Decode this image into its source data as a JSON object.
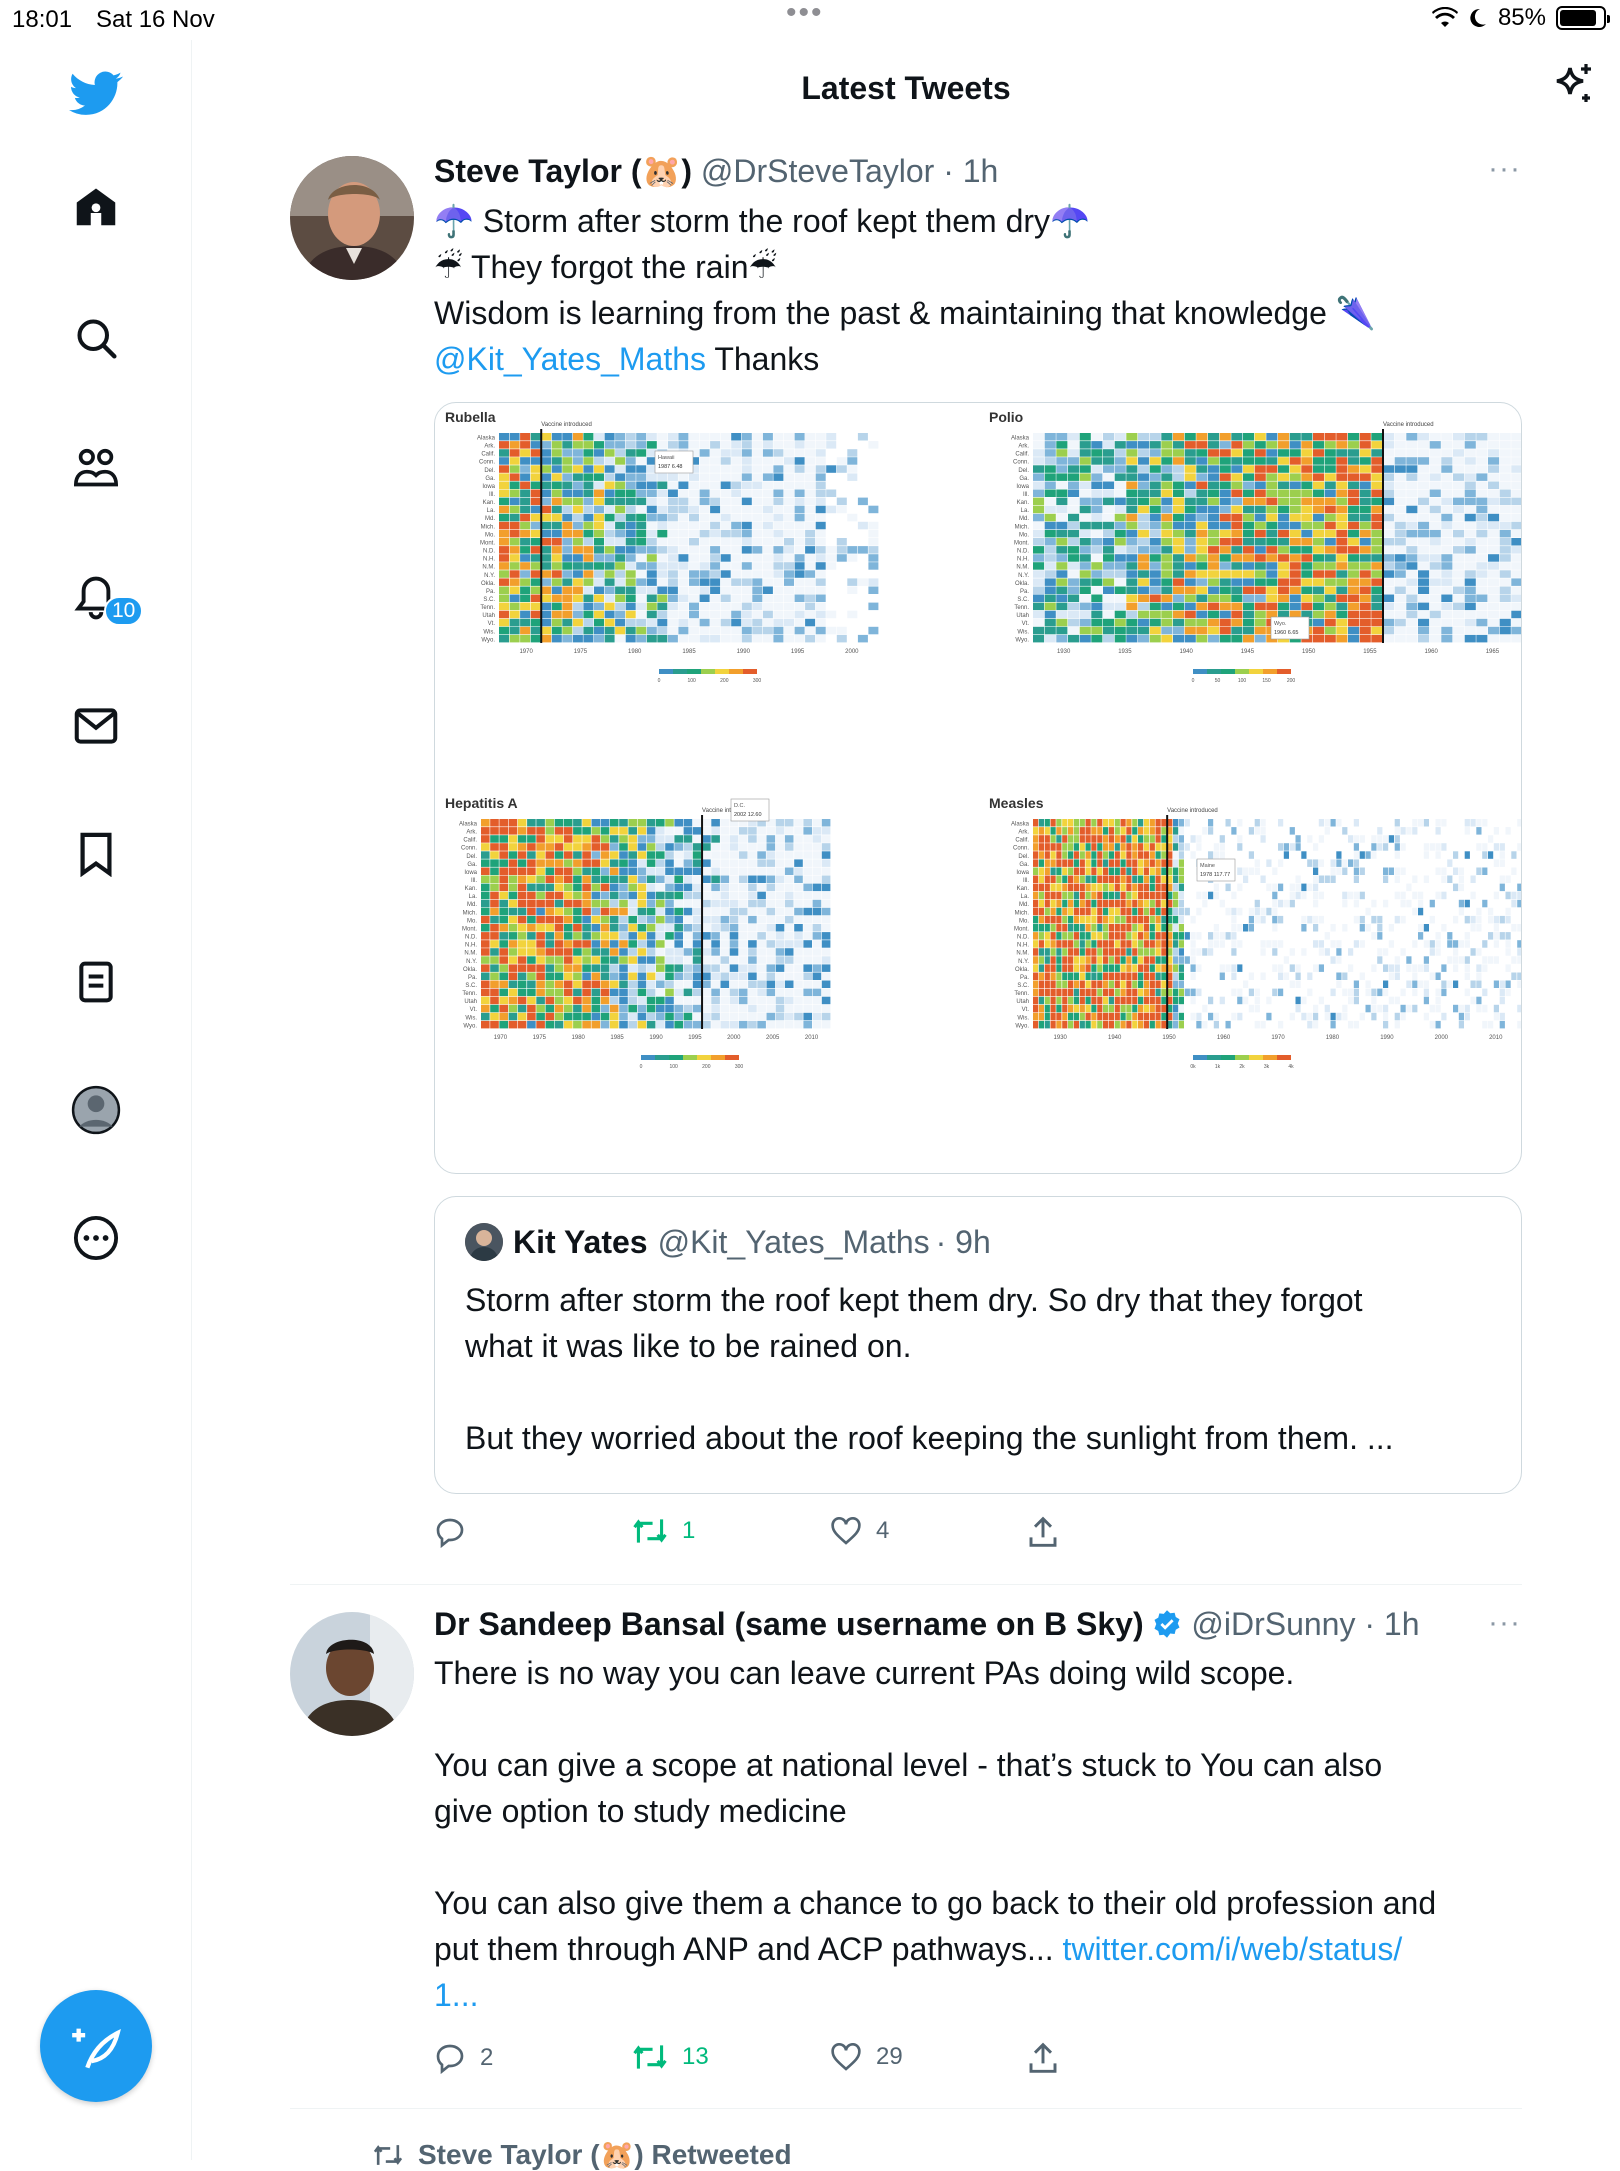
{
  "status_bar": {
    "time": "18:01",
    "date": "Sat 16 Nov",
    "battery": "85%"
  },
  "header": {
    "title": "Latest Tweets"
  },
  "sidebar": {
    "items": [
      {
        "name": "home"
      },
      {
        "name": "explore"
      },
      {
        "name": "communities"
      },
      {
        "name": "notifications",
        "badge": "10"
      },
      {
        "name": "messages"
      },
      {
        "name": "bookmarks"
      },
      {
        "name": "lists"
      },
      {
        "name": "profile"
      },
      {
        "name": "more"
      }
    ]
  },
  "tweets": [
    {
      "name": "Steve Taylor (🐹)",
      "handle": "@DrSteveTaylor",
      "time": "· 1h",
      "text_lines": [
        "☂️ Storm after storm the roof kept them dry☂️",
        "☔ They forgot the rain☔",
        "Wisdom is learning from the past & maintaining that knowledge 🌂"
      ],
      "mention": "@Kit_Yates_Maths",
      "mention_suffix": " Thanks",
      "media": {
        "panels": [
          {
            "title": "Rubella",
            "vaccine_label": "Vaccine introduced",
            "tooltip_state": "Hawaii",
            "tooltip_year": "1987",
            "tooltip_value": "6.48",
            "x_ticks": [
              "1970",
              "1975",
              "1980",
              "1985",
              "1990",
              "1995",
              "2000"
            ],
            "legend_ticks": [
              "0",
              "100",
              "200",
              "300"
            ]
          },
          {
            "title": "Polio",
            "vaccine_label": "Vaccine introduced",
            "tooltip_state": "Wyo.",
            "tooltip_year": "1960",
            "tooltip_value": "6.65",
            "x_ticks": [
              "1930",
              "1935",
              "1940",
              "1945",
              "1950",
              "1955",
              "1960",
              "1965"
            ],
            "legend_ticks": [
              "0",
              "50",
              "100",
              "150",
              "200"
            ]
          },
          {
            "title": "Hepatitis A",
            "vaccine_label": "Vaccine introduced",
            "tooltip_state": "D.C.",
            "tooltip_year": "2002",
            "tooltip_value": "12.60",
            "x_ticks": [
              "1970",
              "1975",
              "1980",
              "1985",
              "1990",
              "1995",
              "2000",
              "2005",
              "2010"
            ],
            "legend_ticks": [
              "0",
              "100",
              "200",
              "300"
            ]
          },
          {
            "title": "Measles",
            "vaccine_label": "Vaccine introduced",
            "tooltip_state": "Maine",
            "tooltip_year": "1978",
            "tooltip_value": "117.77",
            "x_ticks": [
              "1930",
              "1940",
              "1950",
              "1960",
              "1970",
              "1980",
              "1990",
              "2000",
              "2010"
            ],
            "legend_ticks": [
              "0k",
              "1k",
              "2k",
              "3k",
              "4k"
            ]
          }
        ],
        "states": [
          "Alaska",
          "Ark.",
          "Calif.",
          "Conn.",
          "Del.",
          "Ga.",
          "Iowa",
          "Ill.",
          "Kan.",
          "La.",
          "Md.",
          "Mich.",
          "Mo.",
          "Mont.",
          "N.D.",
          "N.H.",
          "N.M.",
          "N.Y.",
          "Okla.",
          "Pa.",
          "S.C.",
          "Tenn.",
          "Utah",
          "Vt.",
          "Wis.",
          "Wyo."
        ]
      },
      "quote": {
        "name": "Kit Yates",
        "handle": "@Kit_Yates_Maths",
        "time": "· 9h",
        "text_lines": [
          "Storm after storm the roof kept them dry. So dry that they forgot",
          "what it was like to be rained on.",
          "",
          "But they worried about the roof keeping the sunlight from them. ..."
        ]
      },
      "actions": {
        "replies": "",
        "retweets": "1",
        "likes": "4"
      }
    },
    {
      "name": "Dr Sandeep Bansal (same username on B Sky)",
      "handle": "@iDrSunny",
      "time": "· 1h",
      "text_lines": [
        "There is no way you can leave current PAs doing wild scope.",
        "",
        "You can give a scope at national level - that’s stuck to   You can also",
        "give option to study medicine",
        "",
        "You can also give them a chance to go back to their old profession and",
        "put them through ANP and ACP pathways..."
      ],
      "link_line1": "twitter.com/i/web/status/",
      "link_line2": "1...",
      "actions": {
        "replies": "2",
        "retweets": "13",
        "likes": "29"
      }
    }
  ],
  "next_item": {
    "retweeted_by": "Steve Taylor (🐹) Retweeted"
  }
}
